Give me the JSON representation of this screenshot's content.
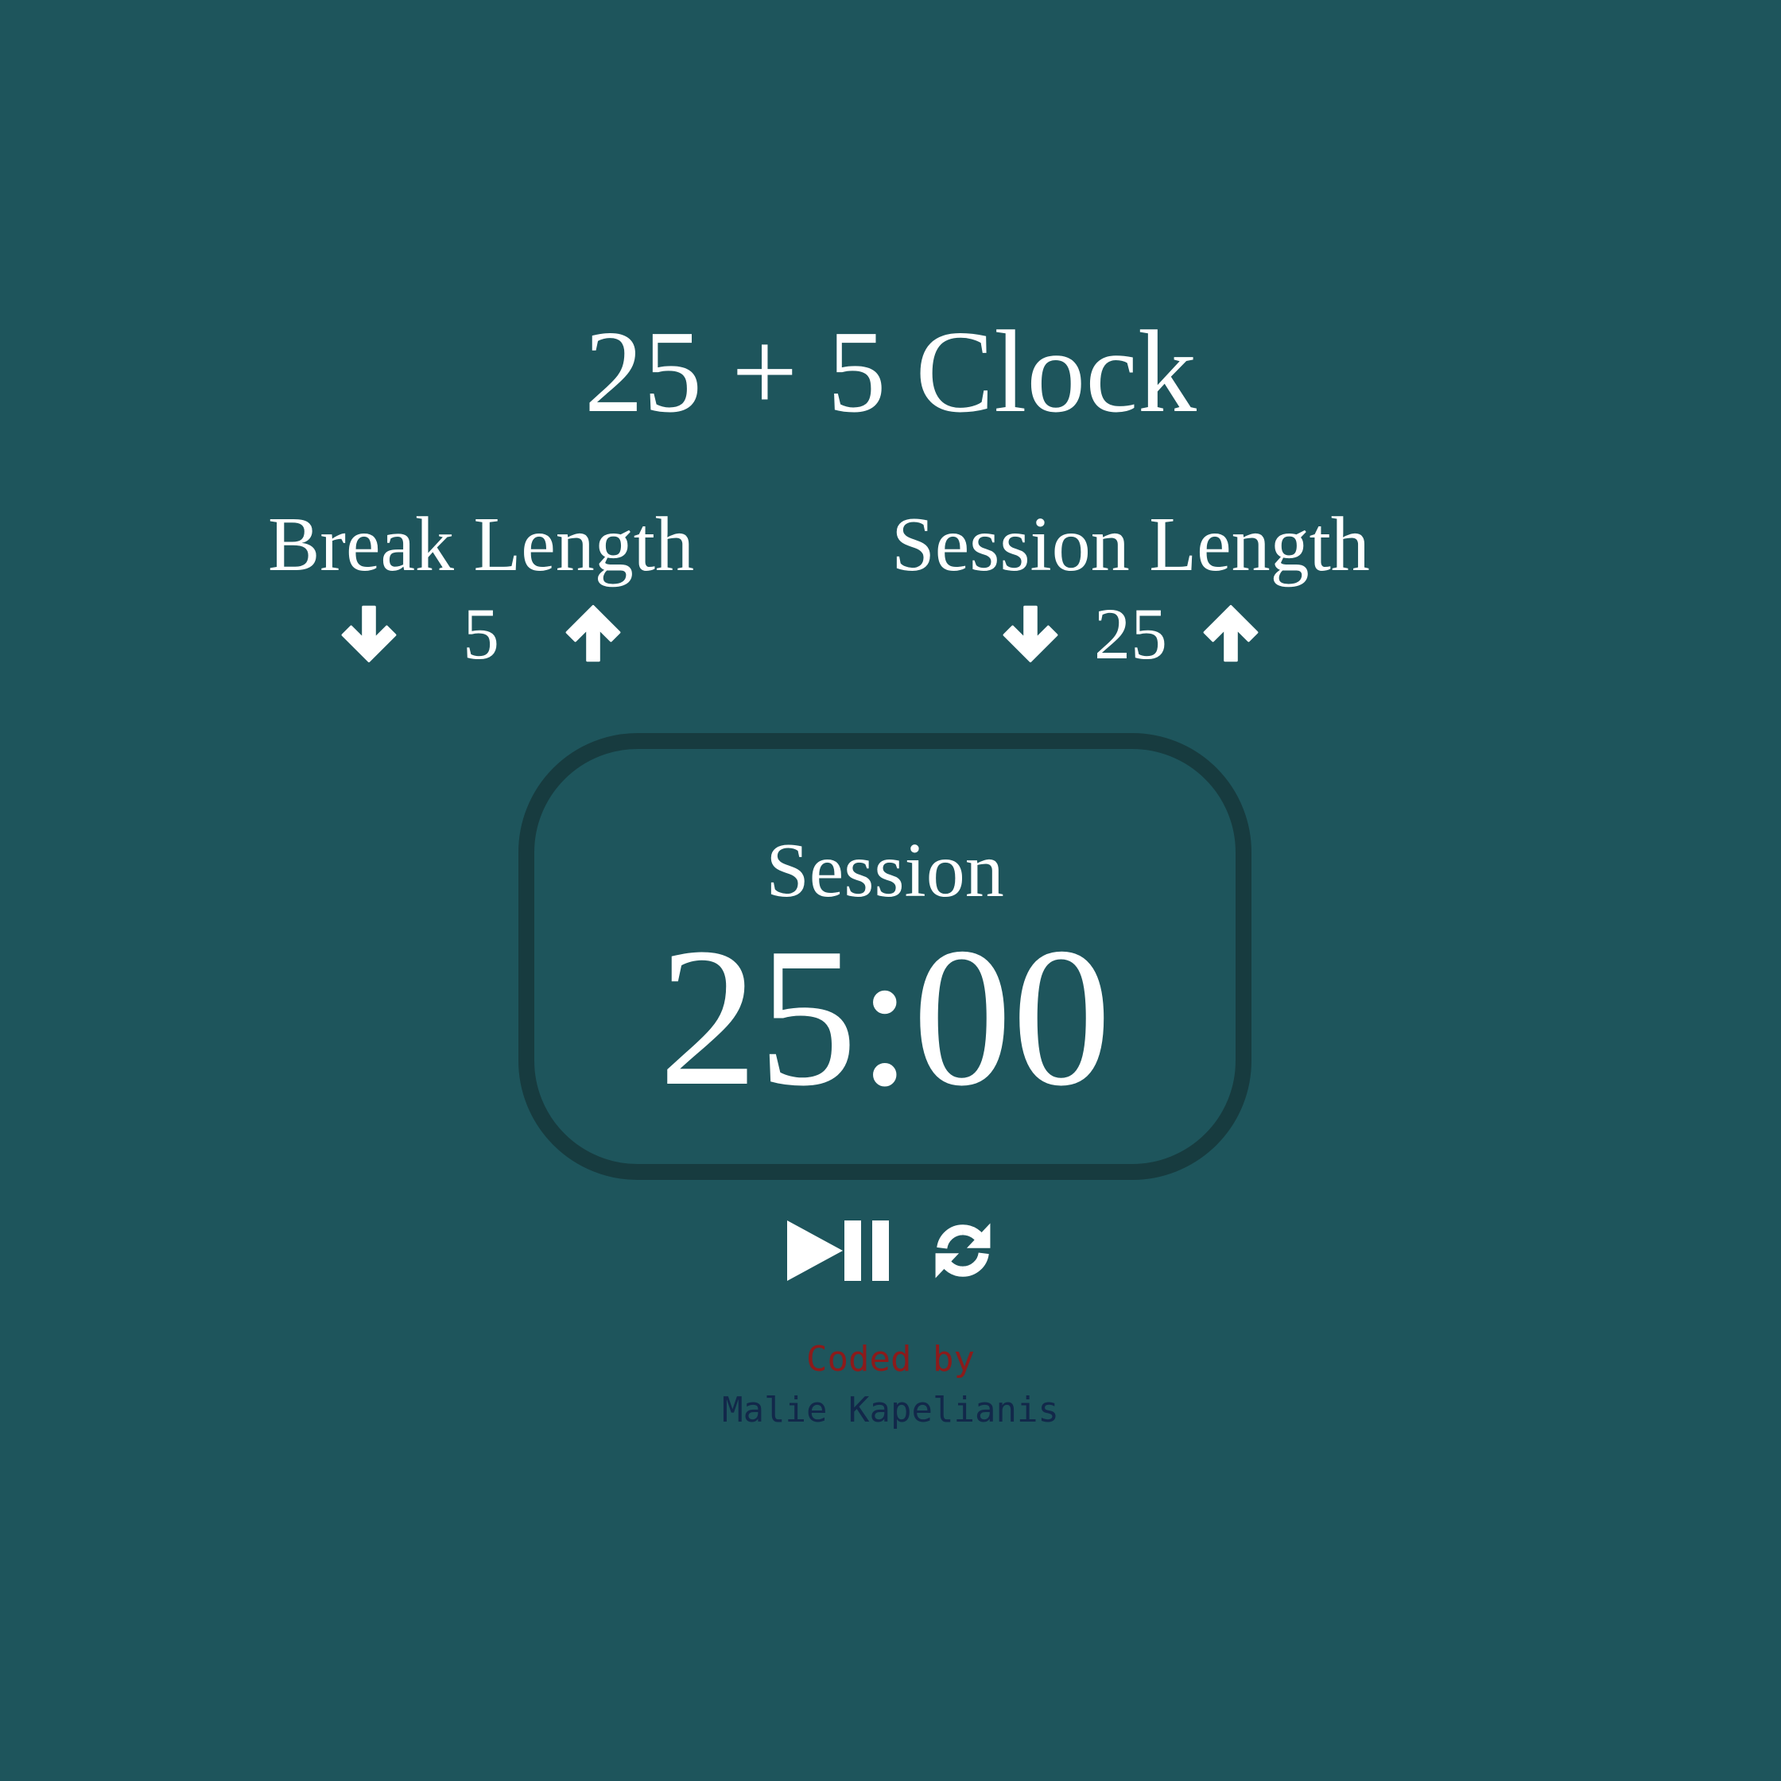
{
  "app": {
    "title": "25 + 5 Clock"
  },
  "break": {
    "label": "Break Length",
    "value": "5",
    "decrement_icon": "arrow-down-icon",
    "increment_icon": "arrow-up-icon"
  },
  "session": {
    "label": "Session Length",
    "value": "25",
    "decrement_icon": "arrow-down-icon",
    "increment_icon": "arrow-up-icon"
  },
  "timer": {
    "label": "Session",
    "time_left": "25:00"
  },
  "controls": {
    "start_stop_icon": "play-pause-icon",
    "reset_icon": "refresh-icon"
  },
  "credit": {
    "line1": "Coded by",
    "line2": "Malie Kapelianis"
  },
  "colors": {
    "background": "#1e555c",
    "text": "#ffffff",
    "timer_border": "#173b3f",
    "credit_line1": "#8b1b1b",
    "credit_line2": "#12284a"
  }
}
